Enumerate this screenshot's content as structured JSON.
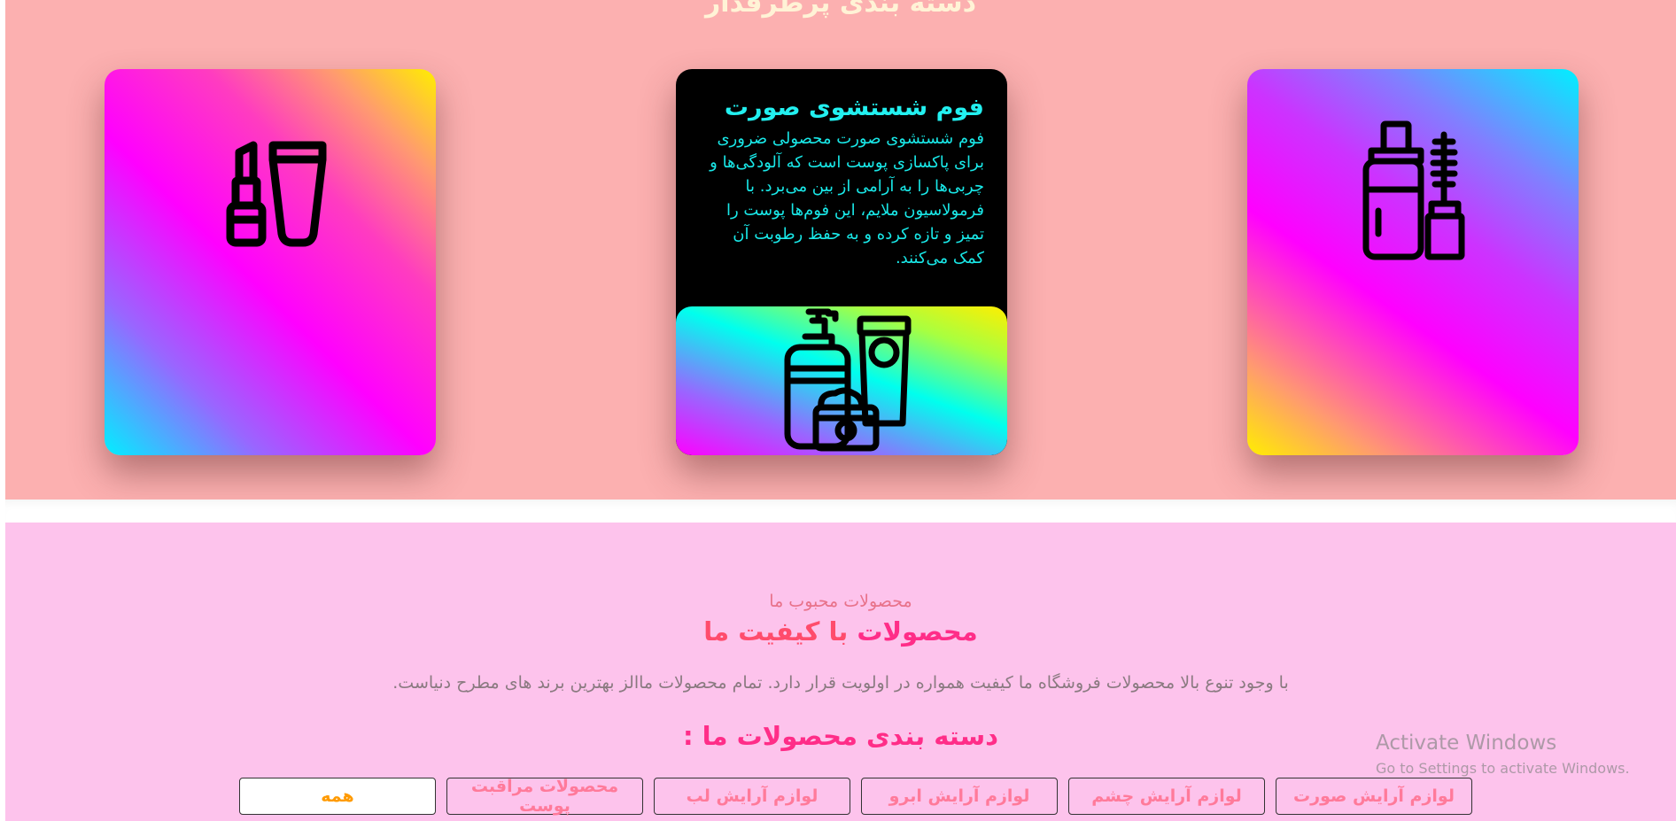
{
  "featured": {
    "title": "دسته بندی پرطرفدار",
    "cards": [
      {
        "icon": "lipstick-cream-icon"
      },
      {
        "title": "فوم شستشوی صورت",
        "text": "فوم شستشوی صورت محصولی ضروری برای پاکسازی پوست است که آلودگی‌ها و چربی‌ها را به آرامی از بین می‌برد. با فرمولاسیون ملایم، این فوم‌ها پوست را تمیز و تازه کرده و به حفظ رطوبت آن کمک می‌کنند.",
        "icon": "skincare-products-icon"
      },
      {
        "icon": "foundation-mascara-icon"
      }
    ]
  },
  "products": {
    "subtitle": "محصولات محبوب ما",
    "heading_a": "محصولات",
    "heading_b": "با کیفیت ما",
    "description": "با وجود تنوع بالا محصولات فروشگاه ما کیفیت همواره در اولویت قرار دارد. تمام محصولات ماالز بهترین برند های مطرح دنیاست.",
    "categories_title": "دسته بندی محصولات ما :",
    "filters": [
      "لوازم آرایش صورت",
      "لوازم آرایش چشم",
      "لوازم آرایش ابرو",
      "لوازم آرایش لب",
      "محصولات مراقبت پوست",
      "همه"
    ]
  },
  "watermark": {
    "line1": "Activate Windows",
    "line2": "Go to Settings to activate Windows."
  }
}
